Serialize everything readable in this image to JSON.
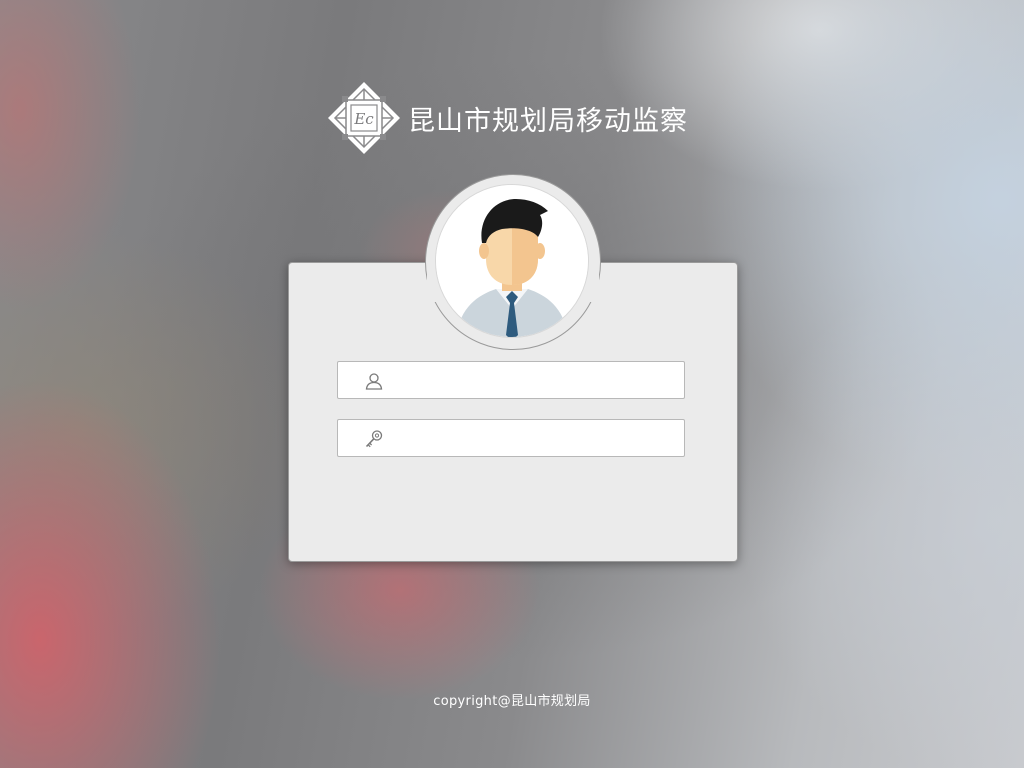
{
  "app": {
    "title": "昆山市规划局移动监察",
    "logo_icon": "seal-emblem-icon",
    "logo_monogram": "Ec"
  },
  "login": {
    "avatar_icon": "user-avatar-icon",
    "username": {
      "icon": "user-icon",
      "value": "",
      "placeholder": ""
    },
    "password": {
      "icon": "key-icon",
      "value": "",
      "placeholder": ""
    }
  },
  "footer": {
    "copyright": "copyright@昆山市规划局"
  },
  "colors": {
    "panel_bg": "#ebebeb",
    "title_text": "#ffffff",
    "tie": "#2e5b7e",
    "hair": "#1a1a1a"
  }
}
